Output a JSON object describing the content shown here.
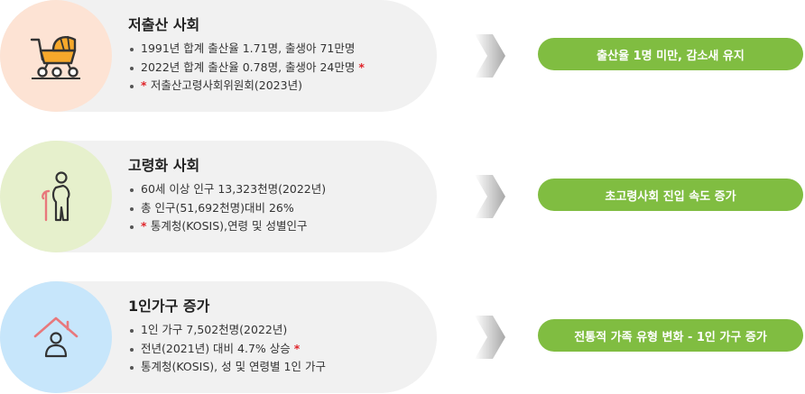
{
  "colors": {
    "pill_bg": "#f1f1f1",
    "badge_green": "#80bd41",
    "accent_red": "#e0242a",
    "circle_peach": "#fde3d4",
    "circle_lime": "#e6f0cc",
    "circle_blue": "#c7e6fb"
  },
  "rows": [
    {
      "icon": "baby-stroller-icon",
      "title": "저출산 사회",
      "bullets": [
        {
          "text": "1991년 합계 출산율 1.71명, 출생아 71만명",
          "prefix_star": "",
          "suffix_star": ""
        },
        {
          "text": "2022년 합계 출산율 0.78명, 출생아 24만명 ",
          "prefix_star": "",
          "suffix_star": "*"
        },
        {
          "text": "저출산고령사회위원회(2023년)",
          "prefix_star": "* ",
          "suffix_star": ""
        }
      ],
      "result": "출산율 1명 미만, 감소새 유지"
    },
    {
      "icon": "elderly-person-cane-icon",
      "title": "고령화 사회",
      "bullets": [
        {
          "text": "60세 이상 인구 13,323천명(2022년)",
          "prefix_star": "",
          "suffix_star": ""
        },
        {
          "text": "총 인구(51,692천명)대비 26%",
          "prefix_star": "",
          "suffix_star": ""
        },
        {
          "text": "통계청(KOSIS),연령 및 성별인구",
          "prefix_star": "* ",
          "suffix_star": ""
        }
      ],
      "result": "초고령사회 진입 속도 증가"
    },
    {
      "icon": "single-person-home-icon",
      "title": "1인가구 증가",
      "bullets": [
        {
          "text": "1인 가구 7,502천명(2022년)",
          "prefix_star": "",
          "suffix_star": ""
        },
        {
          "text": "전년(2021년) 대비 4.7% 상승 ",
          "prefix_star": "",
          "suffix_star": "*"
        },
        {
          "text": "통계청(KOSIS), 성 및 연령별 1인 가구",
          "prefix_star": "",
          "suffix_star": ""
        }
      ],
      "result": "전통적 가족 유형 변화 - 1인 가구 증가"
    }
  ]
}
